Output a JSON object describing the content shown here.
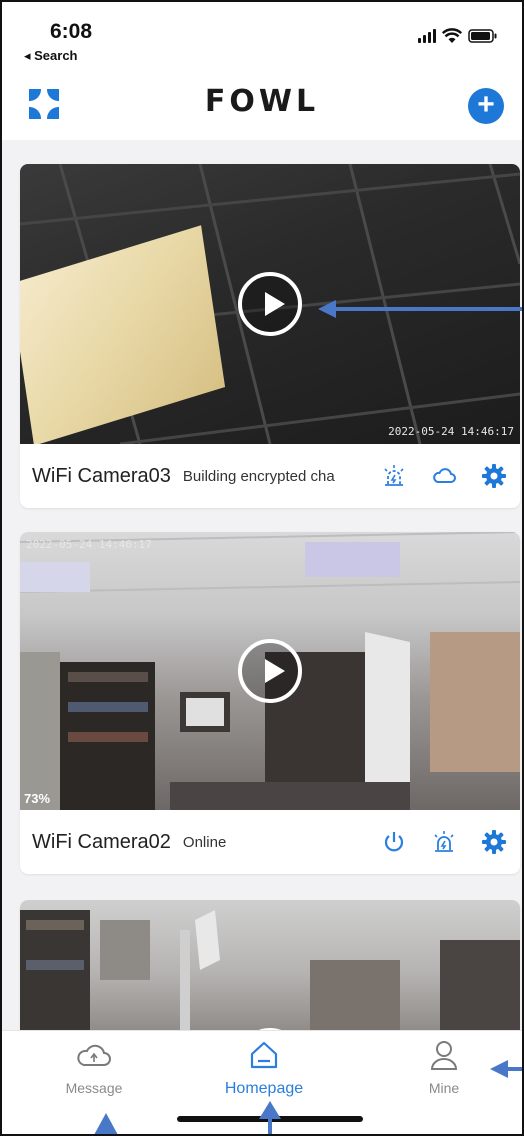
{
  "status": {
    "time": "6:08",
    "back_label": "◂ Search"
  },
  "header": {
    "brand": "FOWL",
    "add_label": "+"
  },
  "cameras": [
    {
      "name": "WiFi Camera03",
      "status": "Building encrypted cha",
      "timestamp": "2022-05-24 14:46:17",
      "icons": [
        "alarm-icon",
        "cloud-icon",
        "gear-icon"
      ]
    },
    {
      "name": "WiFi Camera02",
      "status": "Online",
      "timestamp_top": "2022-05-24 14:46:17",
      "battery": "73%",
      "icons": [
        "power-icon",
        "alarm-icon",
        "gear-icon"
      ]
    },
    {
      "name": "",
      "status": ""
    }
  ],
  "tabs": [
    {
      "label": "Message",
      "icon": "cloud-message-icon"
    },
    {
      "label": "Homepage",
      "icon": "home-icon",
      "active": true
    },
    {
      "label": "Mine",
      "icon": "user-icon"
    }
  ],
  "colors": {
    "accent": "#1e78d8",
    "active_tab": "#2a7ee0",
    "annotation_arrow": "#4a78c8"
  }
}
